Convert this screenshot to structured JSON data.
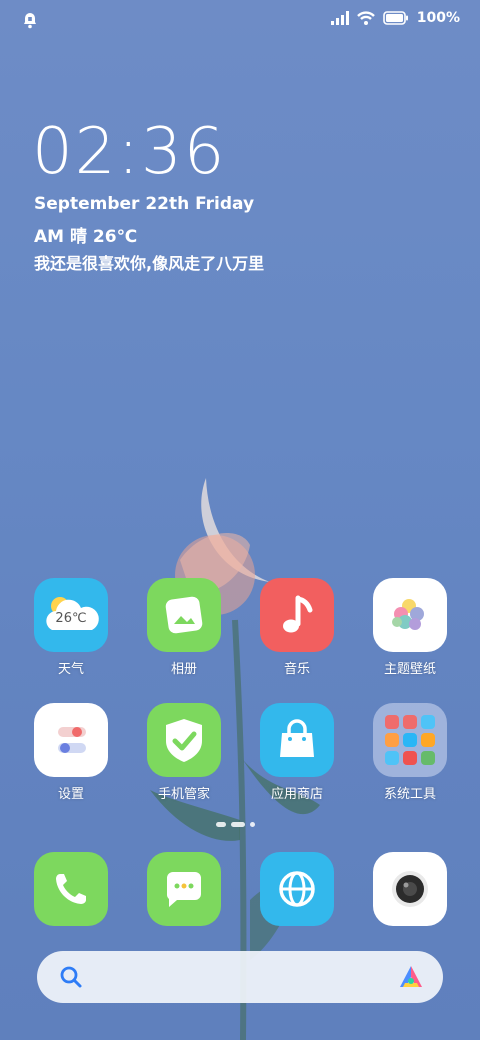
{
  "status_bar": {
    "battery": "100%",
    "icons": [
      "alarm-icon",
      "signal-icon",
      "wifi-icon",
      "battery-icon"
    ]
  },
  "lock": {
    "time": "02:36",
    "date": "September 22th Friday",
    "weather": "AM 晴 26℃",
    "quote": "我还是很喜欢你,像风走了八万里"
  },
  "apps": [
    {
      "label": "天气",
      "icon": "weather-icon",
      "color": "#33b8ec",
      "temp": "26℃"
    },
    {
      "label": "相册",
      "icon": "gallery-icon",
      "color": "#7dd85e"
    },
    {
      "label": "音乐",
      "icon": "music-icon",
      "color": "#f25f5f"
    },
    {
      "label": "主题壁纸",
      "icon": "themes-icon",
      "color": "#ffffff"
    },
    {
      "label": "设置",
      "icon": "settings-icon",
      "color": "#ffffff"
    },
    {
      "label": "手机管家",
      "icon": "security-icon",
      "color": "#7dd85e"
    },
    {
      "label": "应用商店",
      "icon": "app-store-icon",
      "color": "#33b8ec"
    },
    {
      "label": "系统工具",
      "icon": "system-tools-folder-icon",
      "color": "#8aa2d4"
    }
  ],
  "dock": [
    {
      "icon": "phone-icon",
      "color": "#7dd85e"
    },
    {
      "icon": "messages-icon",
      "color": "#7dd85e"
    },
    {
      "icon": "browser-icon",
      "color": "#33b8ec"
    },
    {
      "icon": "camera-icon",
      "color": "#ffffff"
    }
  ],
  "page_indicator": {
    "pages": 3,
    "current": 2
  },
  "search_bar": {
    "icons": [
      "search-icon",
      "app-vault-icon"
    ]
  }
}
